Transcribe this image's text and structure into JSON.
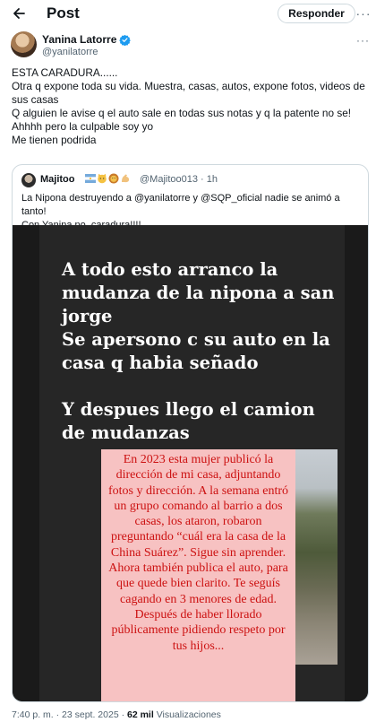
{
  "header": {
    "title": "Post",
    "reply_button": "Responder",
    "more": "···"
  },
  "post": {
    "author_name": "Yanina Latorre",
    "author_handle": "@yanilatorre",
    "more": "···",
    "lines": [
      "ESTA CARADURA......",
      "Otra  q expone toda su vida. Muestra, casas, autos, expone fotos, videos de sus casas",
      "Q alguien le avise q el auto sale en todas sus notas y q la patente no se!",
      "Ahhhh pero la culpable soy yo",
      "Me tienen podrida"
    ]
  },
  "quote": {
    "author_name": "Majitoo",
    "emoji_names": [
      "argentina-flag",
      "cat-face",
      "lion-face",
      "flexed-arm"
    ],
    "handle_time": "@Majitoo013 · 1h",
    "text_line1": "La Nipona destruyendo a @yanilatorre y @SQP_oficial nadie se animó a tanto!",
    "text_line2": "Con Yanina no, caradura!!!!",
    "image": {
      "heading1": "A todo esto arranco la mudanza de la nipona a san jorge",
      "heading2": "Se apersono c su auto en la casa q habia señado",
      "heading3": "Y despues llego el camion de mudanzas",
      "note": "En 2023 esta mujer publicó la dirección de mi casa, adjuntando fotos y dirección. A la semana entró un grupo comando al barrio a dos casas, los ataron, robaron preguntando “cuál era la casa de la China Suárez”. Sigue sin aprender. Ahora también publica el auto, para que quede bien clarito. Te seguís cagando en 3 menores de edad. Después de haber llorado públicamente pidiendo respeto por tus hijos..."
    }
  },
  "footer": {
    "time_date": "7:40 p. m. · 23 sept. 2025 · ",
    "views_count": "62 mil",
    "views_label": " Visualizaciones"
  },
  "colors": {
    "text": "#0f1419",
    "muted": "#536471",
    "verified": "#1d9bf0",
    "note_bg": "#f7c2c2",
    "note_text": "#cc1111",
    "media_bg": "#262626"
  }
}
